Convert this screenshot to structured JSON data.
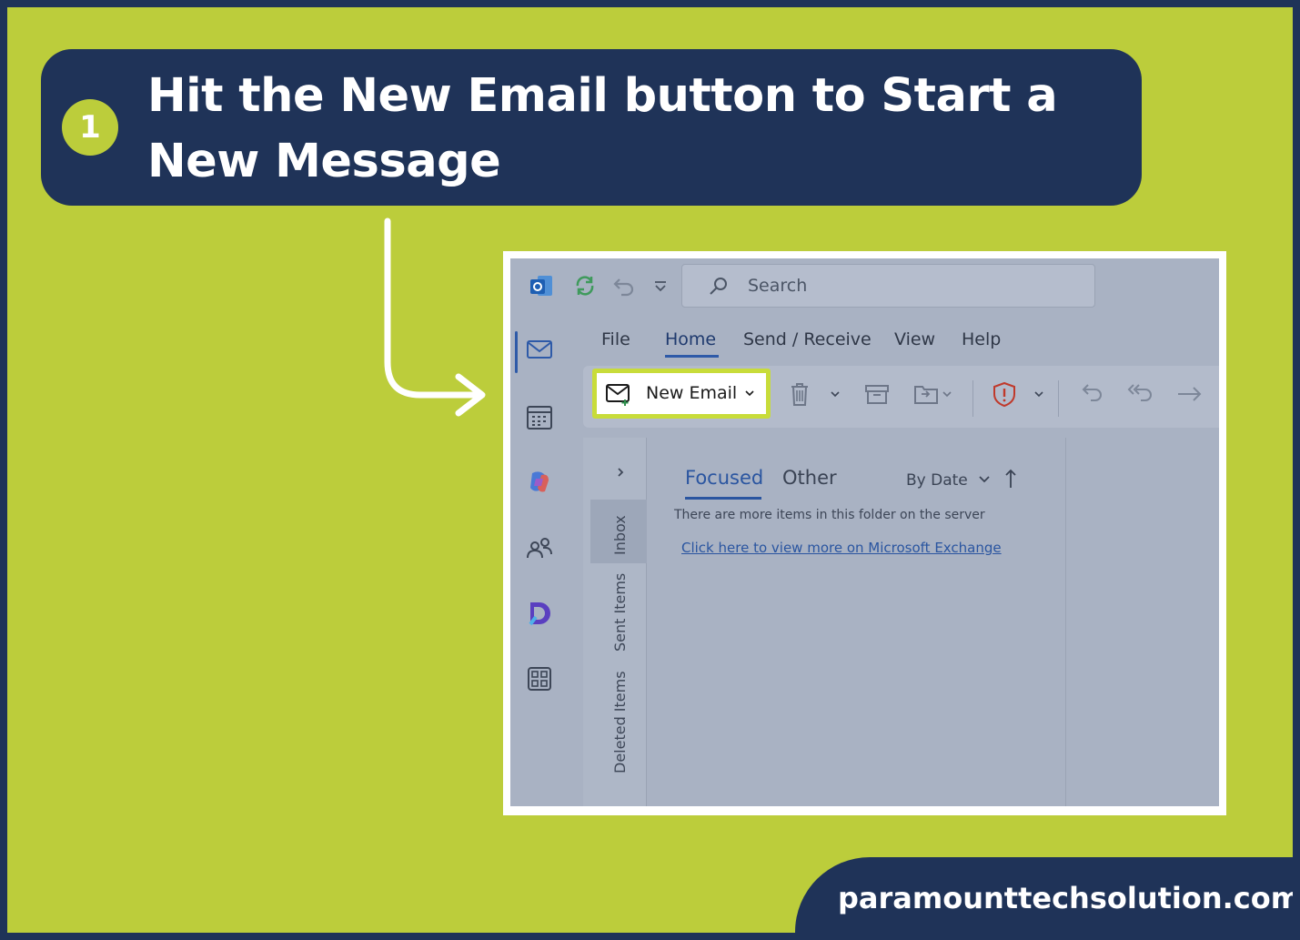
{
  "banner": {
    "step_number": "1",
    "title": "Hit the New Email button to Start a New Message"
  },
  "outlook": {
    "search": {
      "placeholder": "Search"
    },
    "menu_tabs": [
      "File",
      "Home",
      "Send / Receive",
      "View",
      "Help"
    ],
    "active_tab": "Home",
    "toolbar": {
      "new_email_label": "New Email"
    },
    "folders": [
      "Inbox",
      "Sent Items",
      "Deleted Items"
    ],
    "message_list": {
      "tabs": [
        "Focused",
        "Other"
      ],
      "active_tab": "Focused",
      "sort_label": "By Date",
      "info_text": "There are more items in this folder on the server",
      "link_text": "Click here to view more on Microsoft Exchange"
    }
  },
  "footer": {
    "site": "paramounttechsolution.com"
  },
  "colors": {
    "background": "#bccd3b",
    "navy": "#1f3358",
    "highlight": "#c8dc3a",
    "accent_blue": "#2a55a0"
  },
  "icons": [
    "outlook-logo-icon",
    "sync-icon",
    "undo-icon",
    "customize-icon",
    "search-icon",
    "mail-icon",
    "calendar-icon",
    "copilot-icon",
    "people-icon",
    "app-icon",
    "apps-grid-icon",
    "delete-icon",
    "archive-icon",
    "move-icon",
    "report-icon",
    "reply-icon",
    "reply-all-icon",
    "forward-icon",
    "collapse-chevron-icon",
    "sort-arrow-icon"
  ]
}
